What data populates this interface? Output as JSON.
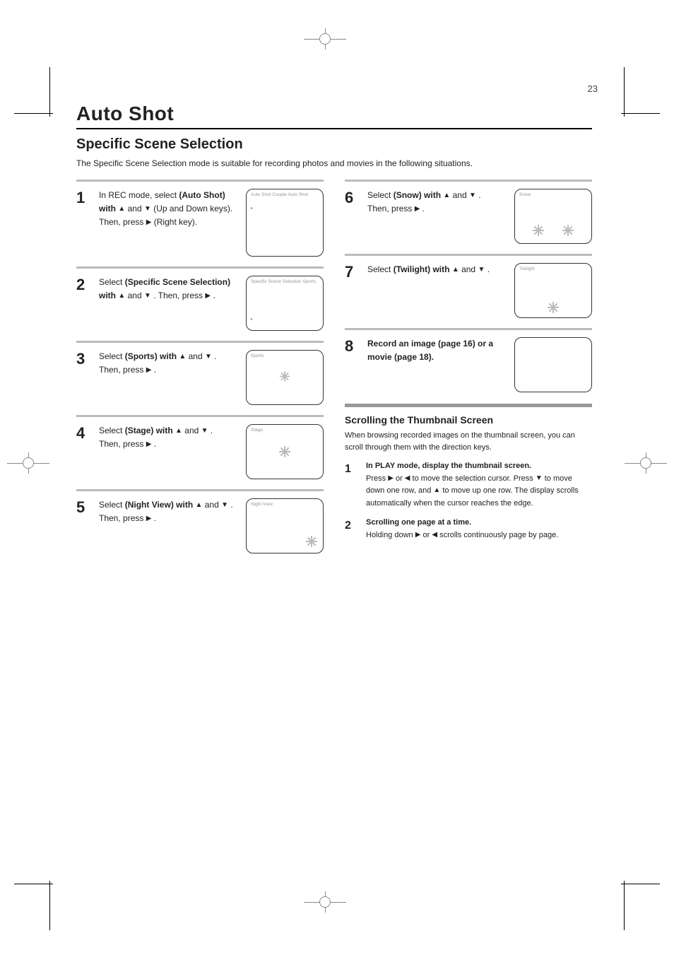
{
  "page_number": "23",
  "section_title": "Auto Shot",
  "headline": "Specific Scene Selection",
  "intro": "The Specific Scene Selection mode is suitable for recording photos and movies in the following situations.",
  "left_steps": [
    {
      "num": "1",
      "text_parts": [
        "In REC mode, select",
        "(Auto Shot) with",
        "and",
        "(Up and Down keys). Then, press",
        "(Right key)."
      ],
      "inline_keys": [
        "▲",
        "▼",
        "▶"
      ],
      "screen": {
        "caption": "Auto Shot\nCouple Auto Shot",
        "marker": "▸"
      }
    },
    {
      "num": "2",
      "text_parts": [
        "Select",
        "(Specific Scene Selection) with",
        "and",
        ". Then, press",
        "."
      ],
      "inline_keys": [
        "▲",
        "▼",
        "▶"
      ],
      "screen": {
        "caption": "Specific Scene Selection\nSports",
        "marker": "▸"
      }
    },
    {
      "num": "3",
      "text_parts": [
        "Select",
        "(Sports) with",
        "and",
        ". Then, press",
        "."
      ],
      "inline_keys": [
        "▲",
        "▼",
        "▶"
      ],
      "screen": {
        "caption": "Sports",
        "icon_pos": "center"
      }
    },
    {
      "num": "4",
      "text_parts": [
        "Select",
        "(Stage) with",
        "and",
        ". Then, press",
        "."
      ],
      "inline_keys": [
        "▲",
        "▼",
        "▶"
      ],
      "screen": {
        "caption": "Stage",
        "icon_pos": "center"
      }
    },
    {
      "num": "5",
      "text_parts": [
        "Select",
        "(Night View) with",
        "and",
        ". Then, press",
        "."
      ],
      "inline_keys": [
        "▲",
        "▼",
        "▶"
      ],
      "screen": {
        "caption": "Night View",
        "icon_pos": "right-bottom"
      }
    }
  ],
  "right_steps": [
    {
      "num": "6",
      "text_parts": [
        "Select",
        "(Snow) with",
        "and",
        ". Then, press",
        "."
      ],
      "inline_keys": [
        "▲",
        "▼",
        "▶"
      ],
      "screen": {
        "caption": "Snow",
        "icons": 2,
        "icons_row": true
      }
    },
    {
      "num": "7",
      "text_parts": [
        "Select",
        "(Twilight) with",
        "and",
        "."
      ],
      "inline_keys": [
        "▲",
        "▼"
      ],
      "screen": {
        "caption": "Twilight",
        "icons": 1,
        "icon_pos": "center-bottom"
      }
    },
    {
      "num": "8",
      "text_parts": [
        "Record an image (page 16) or a movie (page 18)."
      ],
      "inline_keys": [],
      "screen": {
        "caption": "",
        "empty": true
      }
    }
  ],
  "scroll_section": {
    "heading": "Scrolling the Thumbnail Screen",
    "intro": "When browsing recorded images on the thumbnail screen, you can scroll through them with the direction keys.",
    "steps": [
      {
        "num": "1",
        "text": "In PLAY mode, display the thumbnail screen.",
        "detail": "Press ▶ or ◀ to move the selection cursor. Press ▼ to move down one row, and ▲ to move up one row. The display scrolls automatically when the cursor reaches the edge."
      },
      {
        "num": "2",
        "text": "Scrolling one page at a time.",
        "detail": "Holding down ▶ or ◀ scrolls continuously page by page."
      }
    ]
  }
}
